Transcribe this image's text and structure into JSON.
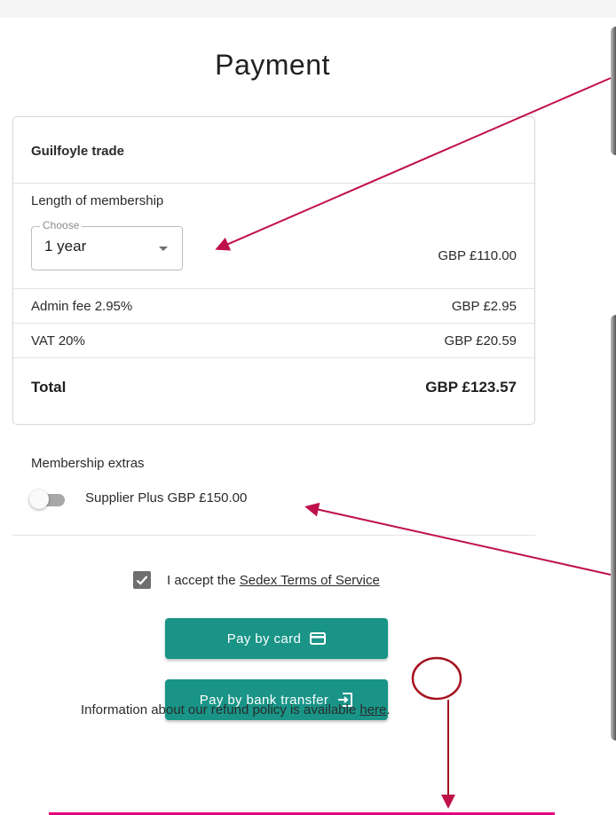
{
  "page": {
    "title": "Payment"
  },
  "summary": {
    "company": "Guilfoyle trade",
    "membership": {
      "label": "Length of membership",
      "select_legend": "Choose",
      "select_value": "1 year",
      "price": "GBP £110.00"
    },
    "admin_fee": {
      "label": "Admin fee 2.95%",
      "value": "GBP £2.95"
    },
    "vat": {
      "label": "VAT 20%",
      "value": "GBP £20.59"
    },
    "total": {
      "label": "Total",
      "value": "GBP £123.57"
    }
  },
  "extras": {
    "title": "Membership extras",
    "items": [
      {
        "label": "Supplier Plus GBP £150.00",
        "enabled": false
      }
    ]
  },
  "terms": {
    "checked": true,
    "prefix": "I accept the ",
    "link_text": "Sedex Terms of Service"
  },
  "buttons": {
    "pay_card": "Pay by card",
    "pay_bank": "Pay by bank transfer"
  },
  "refund": {
    "prefix": "Information about our refund policy is available ",
    "link_text": "here",
    "suffix": "."
  },
  "colors": {
    "accent": "#199487",
    "annotation": "#c0104a",
    "annotation_circle": "#a5121e",
    "highlight_bar": "#e4007c"
  },
  "icons": {
    "pay_card": "credit-card-icon",
    "pay_bank": "bank-transfer-icon",
    "checkbox": "checkmark-icon",
    "select": "caret-down-icon"
  }
}
